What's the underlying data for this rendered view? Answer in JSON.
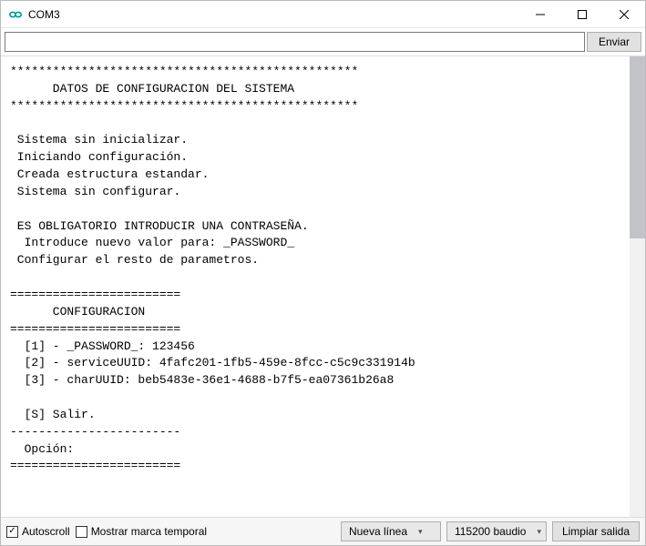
{
  "window": {
    "title": "COM3"
  },
  "input": {
    "value": "",
    "send_label": "Enviar"
  },
  "console": {
    "text": "*************************************************\n      DATOS DE CONFIGURACION DEL SISTEMA\n*************************************************\n\n Sistema sin inicializar.\n Iniciando configuración.\n Creada estructura estandar.\n Sistema sin configurar.\n\n ES OBLIGATORIO INTRODUCIR UNA CONTRASEÑA.\n  Introduce nuevo valor para: _PASSWORD_\n Configurar el resto de parametros.\n\n========================\n      CONFIGURACION\n========================\n  [1] - _PASSWORD_: 123456\n  [2] - serviceUUID: 4fafc201-1fb5-459e-8fcc-c5c9c331914b\n  [3] - charUUID: beb5483e-36e1-4688-b7f5-ea07361b26a8\n\n  [S] Salir.\n------------------------\n  Opción:\n========================"
  },
  "bottom": {
    "autoscroll_label": "Autoscroll",
    "autoscroll_checked": true,
    "timestamp_label": "Mostrar marca temporal",
    "timestamp_checked": false,
    "line_ending": {
      "selected": "Nueva línea"
    },
    "baud": {
      "selected": "115200 baudio"
    },
    "clear_label": "Limpiar salida"
  }
}
